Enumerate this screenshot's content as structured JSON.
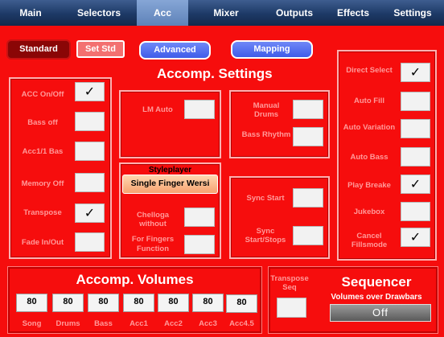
{
  "tabs": [
    {
      "label": "Main"
    },
    {
      "label": "Selectors"
    },
    {
      "label": "Acc",
      "active": true
    },
    {
      "label": "Mixer"
    },
    {
      "label": "Outputs"
    },
    {
      "label": "Effects"
    },
    {
      "label": "Settings"
    }
  ],
  "buttons": {
    "standard": "Standard",
    "set_std": "Set Std",
    "advanced": "Advanced",
    "mapping": "Mapping"
  },
  "accomp_settings_title": "Accomp. Settings",
  "left_options": [
    {
      "label": "ACC On/Off",
      "checked": true
    },
    {
      "label": "Bass off",
      "checked": false
    },
    {
      "label": "Acc1/1 Bas",
      "checked": false
    },
    {
      "label": "Memory Off",
      "checked": false
    },
    {
      "label": "Transpose",
      "checked": true
    },
    {
      "label": "Fade In/Out",
      "checked": false
    }
  ],
  "lm_auto": {
    "label": "LM Auto",
    "checked": false
  },
  "manual": {
    "manual_drums": "Manual Drums",
    "bass_rhythm": "Bass Rhythm"
  },
  "styleplayer": {
    "title": "Styleplayer",
    "selected": "Single Finger Wersi",
    "chelloga": "Chelloga without",
    "for_fingers": "For Fingers",
    "function": "Function"
  },
  "sync": {
    "sync_start": "Sync Start",
    "sync_start_stop": "Sync Start/Stops"
  },
  "right_options": [
    {
      "label": "Direct Select",
      "checked": true
    },
    {
      "label": "Auto Fill",
      "checked": false
    },
    {
      "label": "Auto Variation",
      "checked": false
    },
    {
      "label": "Auto Bass",
      "checked": false
    },
    {
      "label": "Play Breake",
      "checked": true
    },
    {
      "label": "Jukebox",
      "checked": false
    },
    {
      "label": "Cancel Fillsmode",
      "checked": true
    }
  ],
  "check_mark": "✓",
  "volumes": {
    "title": "Accomp. Volumes",
    "channels": [
      {
        "name": "Song",
        "value": "80"
      },
      {
        "name": "Drums",
        "value": "80"
      },
      {
        "name": "Bass",
        "value": "80"
      },
      {
        "name": "Acc1",
        "value": "80"
      },
      {
        "name": "Acc2",
        "value": "80"
      },
      {
        "name": "Acc3",
        "value": "80"
      },
      {
        "name": "Acc4.5",
        "value": "80"
      }
    ]
  },
  "sequencer": {
    "transpose_seq": "Transpose Seq",
    "title": "Sequencer",
    "subtitle": "Volumes over Drawbars",
    "state": "Off"
  }
}
